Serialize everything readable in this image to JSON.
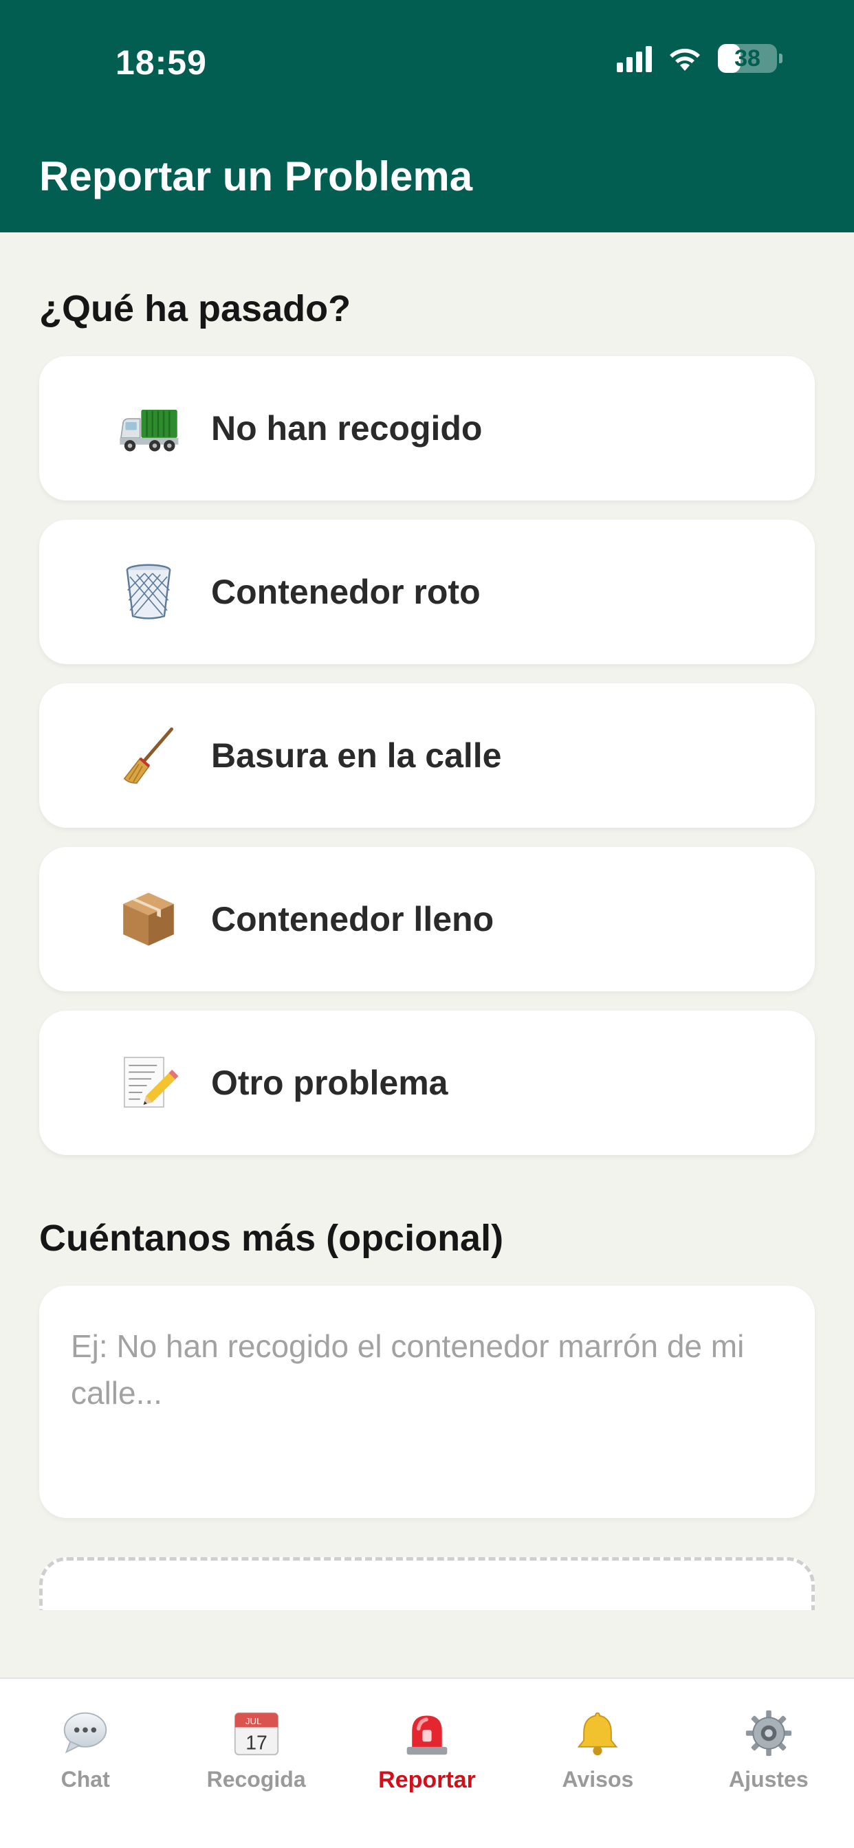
{
  "status_bar": {
    "time": "18:59",
    "battery": "38",
    "battery_level": 0.38
  },
  "header": {
    "title": "Reportar un Problema"
  },
  "question": {
    "title": "¿Qué ha pasado?"
  },
  "options": [
    {
      "label": "No han recogido",
      "icon": "garbage-truck-icon"
    },
    {
      "label": "Contenedor roto",
      "icon": "wastebasket-icon"
    },
    {
      "label": "Basura en la calle",
      "icon": "broom-icon"
    },
    {
      "label": "Contenedor lleno",
      "icon": "package-icon"
    },
    {
      "label": "Otro problema",
      "icon": "memo-icon"
    }
  ],
  "details": {
    "title": "Cuéntanos más (opcional)",
    "placeholder": "Ej: No han recogido el contenedor marrón de mi calle...",
    "value": ""
  },
  "tabs": [
    {
      "label": "Chat",
      "icon": "speech-bubble-icon",
      "active": false
    },
    {
      "label": "Recogida",
      "icon": "calendar-icon",
      "active": false,
      "icon_month": "JUL",
      "icon_day": "17"
    },
    {
      "label": "Reportar",
      "icon": "siren-icon",
      "active": true
    },
    {
      "label": "Avisos",
      "icon": "bell-icon",
      "active": false
    },
    {
      "label": "Ajustes",
      "icon": "gear-icon",
      "active": false
    }
  ],
  "colors": {
    "header_bg": "#015e50",
    "page_bg": "#f3f3ee",
    "active_tab": "#d0111b",
    "inactive_tab": "#9a9a9a"
  }
}
